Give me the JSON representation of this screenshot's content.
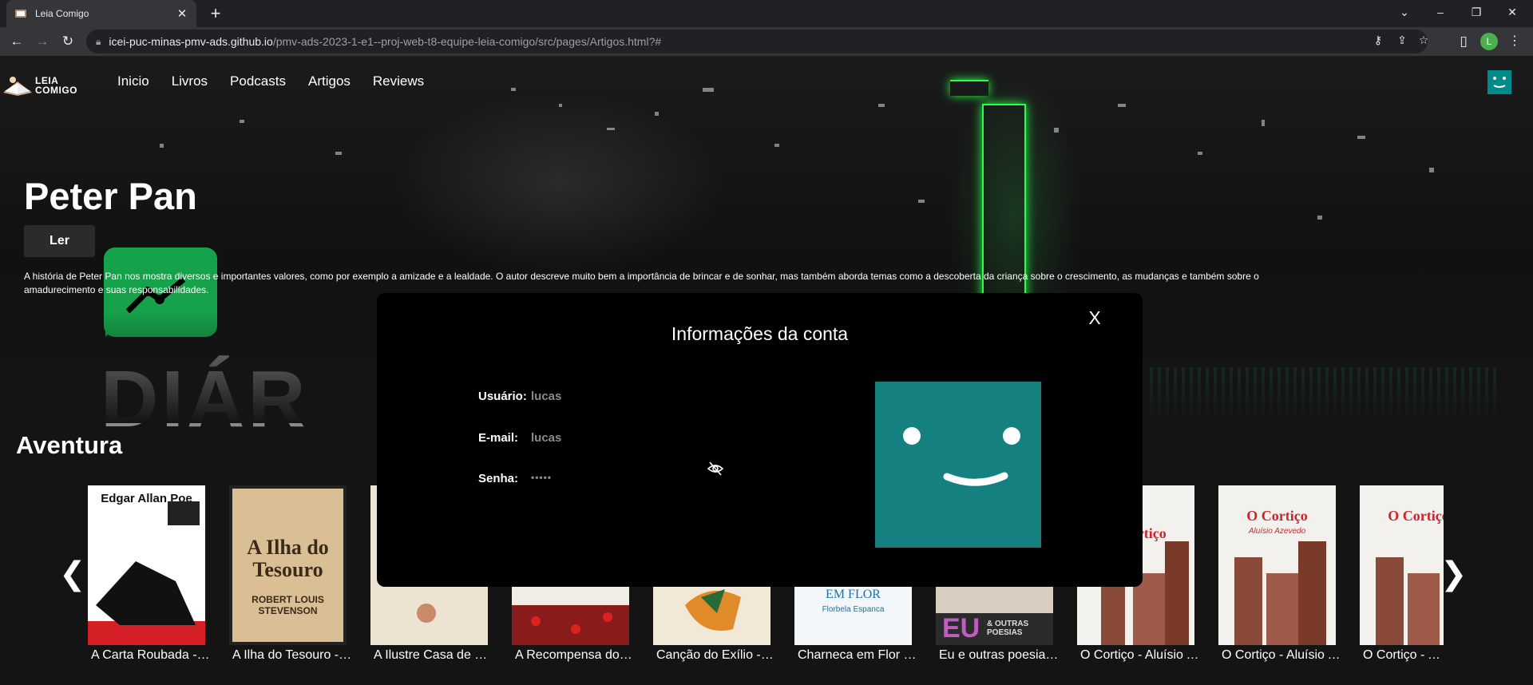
{
  "browser": {
    "tab_title": "Leia Comigo",
    "tab_close": "✕",
    "new_tab": "+",
    "url_host": "icei-puc-minas-pmv-ads.github.io",
    "url_path": "/pmv-ads-2023-1-e1--proj-web-t8-equipe-leia-comigo/src/pages/Artigos.html?#",
    "profile_initial": "L",
    "icons": [
      "key-icon",
      "share-icon",
      "star-icon",
      "sidebar-icon"
    ]
  },
  "site": {
    "logo_line1": "LEIA",
    "logo_line2": "COMIGO",
    "nav": [
      "Inicio",
      "Livros",
      "Podcasts",
      "Artigos",
      "Reviews"
    ]
  },
  "hero": {
    "title": "Peter Pan",
    "read_label": "Ler",
    "description": "A história de Peter Pan nos mostra diversos e importantes valores, como por exemplo a amizade e a lealdade. O autor descreve muito bem a importância de brincar e de sonhar, mas também aborda temas como a descoberta da criança sobre o crescimento, as mudanças e também sobre o amadurecimento e suas responsabilidades.",
    "bg_text": "DIÁR"
  },
  "section": {
    "title": "Aventura",
    "prev": "❮",
    "next": "❯"
  },
  "books": [
    {
      "label": "A Carta Roubada - Edgar Allan Poe",
      "cover_color": "#ffffff",
      "cover_text": "Edgar Allan Poe"
    },
    {
      "label": "A Ilha do Tesouro - Robert Louis Stevenson",
      "cover_color": "#d9bf93",
      "cover_text": "A Ilha do Tesouro"
    },
    {
      "label": "A Ilustre Casa de Ramires - Eça de Queirós",
      "cover_color": "#ece3d2",
      "cover_text": ""
    },
    {
      "label": "A Recompensa do Vira-Lata",
      "cover_color": "#f2ede4",
      "cover_text": ""
    },
    {
      "label": "Canção do Exílio - Gonçalves Dias",
      "cover_color": "#f1e8d6",
      "cover_text": ""
    },
    {
      "label": "Charneca em Flor - Florbela Espanca",
      "cover_color": "#f4f7f9",
      "cover_text": "EM FLOR"
    },
    {
      "label": "Eu e outras poesias - Augusto dos Anjos",
      "cover_color": "#d8cdbf",
      "cover_text": "EU"
    },
    {
      "label": "O Cortiço - Aluísio Azevedo",
      "cover_color": "#f3f1ee",
      "cover_text": "O Cortiço"
    },
    {
      "label": "O Cortiço - Aluísio Azevedo",
      "cover_color": "#f3f1ee",
      "cover_text": "O Cortiço"
    },
    {
      "label": "O Cortiço - Aluísio Azevedo",
      "cover_color": "#f3f1ee",
      "cover_text": "O Cortiço"
    }
  ],
  "modal": {
    "title": "Informações da conta",
    "close_label": "X",
    "user_label": "Usuário:",
    "user_value": "lucas",
    "email_label": "E-mail:",
    "email_value": "lucas",
    "password_label": "Senha:",
    "password_value": "•••••"
  },
  "colors": {
    "accent_teal": "#158080",
    "avatar_small": "#008a8a"
  }
}
